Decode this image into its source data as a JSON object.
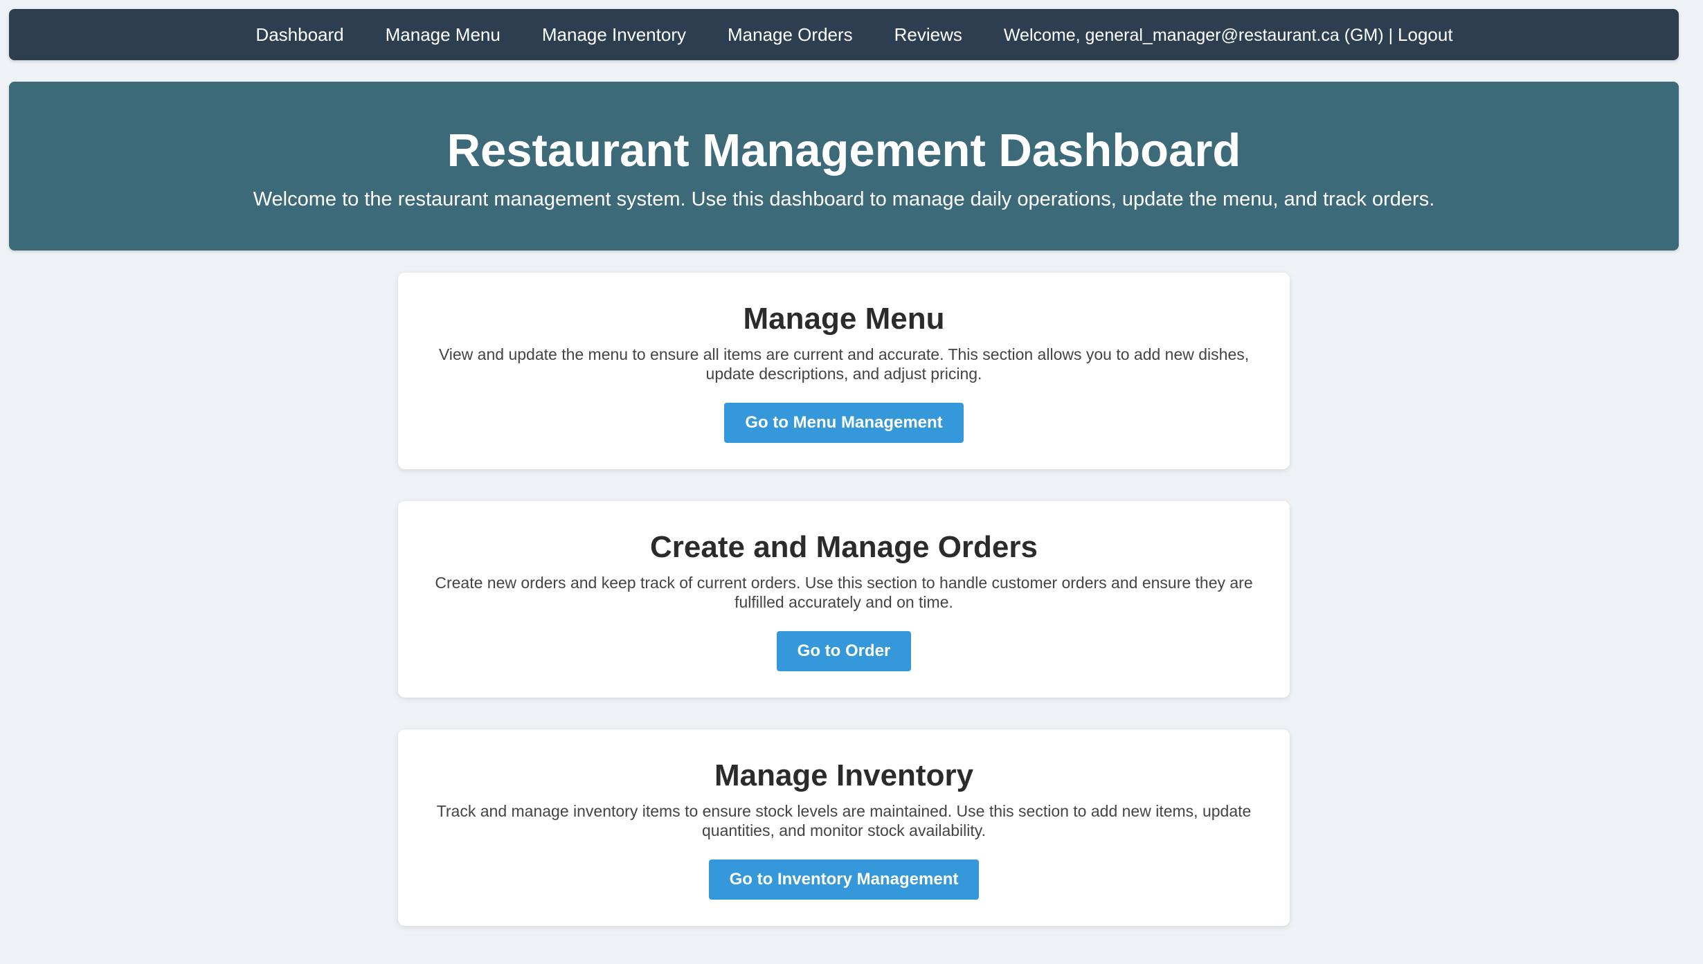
{
  "nav": {
    "links": [
      "Dashboard",
      "Manage Menu",
      "Manage Inventory",
      "Manage Orders",
      "Reviews"
    ],
    "welcome_text": "Welcome, general_manager@restaurant.ca (GM) | ",
    "logout_label": "Logout"
  },
  "hero": {
    "title": "Restaurant Management Dashboard",
    "subtitle": "Welcome to the restaurant management system. Use this dashboard to manage daily operations, update the menu, and track orders."
  },
  "cards": [
    {
      "title": "Manage Menu",
      "description": "View and update the menu to ensure all items are current and accurate. This section allows you to add new dishes, update descriptions, and adjust pricing.",
      "button_label": "Go to Menu Management"
    },
    {
      "title": "Create and Manage Orders",
      "description": "Create new orders and keep track of current orders. Use this section to handle customer orders and ensure they are fulfilled accurately and on time.",
      "button_label": "Go to Order"
    },
    {
      "title": "Manage Inventory",
      "description": "Track and manage inventory items to ensure stock levels are maintained. Use this section to add new items, update quantities, and monitor stock availability.",
      "button_label": "Go to Inventory Management"
    }
  ],
  "colors": {
    "page_background": "#eef1f6",
    "navbar": "#2c3e50",
    "hero": "#3c6a79",
    "button": "#3498db",
    "card": "#ffffff"
  }
}
